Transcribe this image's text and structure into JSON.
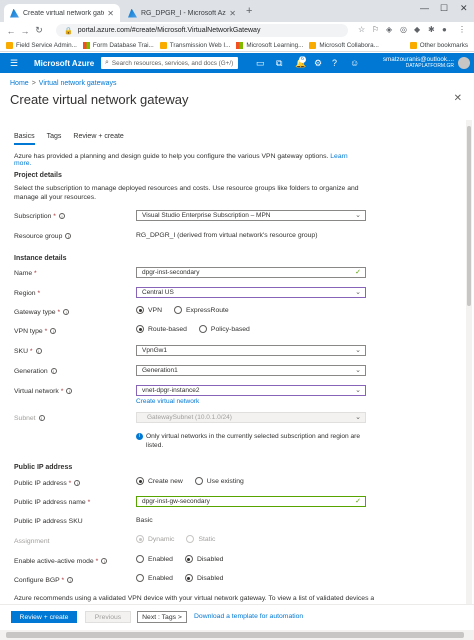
{
  "browser": {
    "tabs": [
      {
        "title": "Create virtual network gateway",
        "active": true
      },
      {
        "title": "RG_DPGR_I - Microsoft Azure",
        "active": false
      }
    ],
    "url": "portal.azure.com/#create/Microsoft.VirtualNetworkGateway",
    "bookmarks": [
      "Field Service Admin...",
      "Form Database Trai...",
      "Transmission Web I...",
      "Microsoft Learning...",
      "Microsoft Collabora...",
      "Other bookmarks"
    ]
  },
  "azure": {
    "brand": "Microsoft Azure",
    "search_placeholder": "Search resources, services, and docs (G+/)",
    "notification_count": "6",
    "account_name": "smatzouranis@outlook....",
    "account_directory": "DATAPLATFORM.GR"
  },
  "page": {
    "breadcrumb": [
      "Home",
      "Virtual network gateways"
    ],
    "title": "Create virtual network gateway",
    "tabs": [
      "Basics",
      "Tags",
      "Review + create"
    ],
    "intro": "Azure has provided a planning and design guide to help you configure the various VPN gateway options.",
    "learn_more": "Learn more.",
    "project_details_heading": "Project details",
    "project_details_desc": "Select the subscription to manage deployed resources and costs. Use resource groups like folders to organize and manage all your resources.",
    "subscription_label": "Subscription",
    "subscription_value": "Visual Studio Enterprise Subscription – MPN",
    "resource_group_label": "Resource group",
    "resource_group_value": "RG_DPGR_I (derived from virtual network's resource group)",
    "instance_details_heading": "Instance details",
    "name_label": "Name",
    "name_value": "dpgr-inst-secondary",
    "region_label": "Region",
    "region_value": "Central US",
    "gateway_type_label": "Gateway type",
    "gateway_type_options": [
      "VPN",
      "ExpressRoute"
    ],
    "vpn_type_label": "VPN type",
    "vpn_type_options": [
      "Route-based",
      "Policy-based"
    ],
    "sku_label": "SKU",
    "sku_value": "VpnGw1",
    "generation_label": "Generation",
    "generation_value": "Generation1",
    "virtual_network_label": "Virtual network",
    "virtual_network_value": "vnet-dpgr-instance2",
    "create_vnet_link": "Create virtual network",
    "subnet_label": "Subnet",
    "subnet_value": "GatewaySubnet (10.0.1.0/24)",
    "subnet_info": "Only virtual networks in the currently selected subscription and region are listed.",
    "public_ip_heading": "Public IP address",
    "public_ip_label": "Public IP address",
    "public_ip_options": [
      "Create new",
      "Use existing"
    ],
    "public_ip_name_label": "Public IP address name",
    "public_ip_name_value": "dpgr-inst-gw-secondary",
    "public_ip_sku_label": "Public IP address SKU",
    "public_ip_sku_value": "Basic",
    "assignment_label": "Assignment",
    "assignment_options": [
      "Dynamic",
      "Static"
    ],
    "active_active_label": "Enable active-active mode",
    "active_active_options": [
      "Enabled",
      "Disabled"
    ],
    "bgp_label": "Configure BGP",
    "bgp_options": [
      "Enabled",
      "Disabled"
    ],
    "recommend_text": "Azure recommends using a validated VPN device with your virtual network gateway. To view a list of validated devices and"
  },
  "footer": {
    "review_create": "Review + create",
    "previous": "Previous",
    "next": "Next : Tags >",
    "download": "Download a template for automation"
  }
}
